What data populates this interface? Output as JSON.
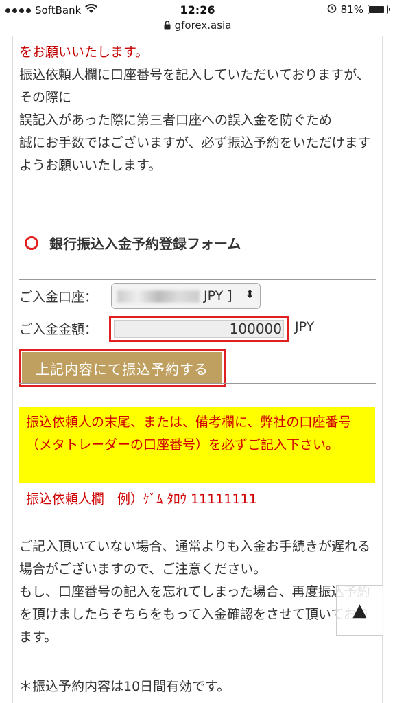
{
  "status_bar": {
    "carrier": "SoftBank",
    "time": "12:26",
    "battery": "81%"
  },
  "url": "gforex.asia",
  "content": {
    "intro_red": "をお願いいたします。",
    "intro_lines": [
      "振込依頼人欄に口座番号を記入していただいておりますが、その際に",
      "誤記入があった際に第三者口座への誤入金を防ぐため",
      "誠にお手数ではございますが、必ず振込予約をいただけますようお願いいたします。"
    ],
    "section_title": "銀行振込入金予約登録フォーム",
    "form": {
      "account_label": "ご入金口座：",
      "account_value": "JPY ]",
      "amount_label": "ご入金金額：",
      "amount_value": "100000",
      "amount_unit": "JPY",
      "submit_label": "上記内容にて振込予約する"
    },
    "notice": "振込依頼人の末尾、または、備考欄に、弊社の口座番号（メタトレーダーの口座番号）を必ずご記入下さい。",
    "example": "振込依頼人欄　例）ｹﾞﾑ ﾀﾛｳ 11111111",
    "warning_lines": [
      "ご記入頂いていない場合、通常よりも入金お手続きが遅れる場合がございますので、ご注意ください。",
      "もし、口座番号の記入を忘れてしまった場合、再度振込予約を頂けましたらそちらをもって入金確認をさせて頂いております。"
    ],
    "validity": "＊振込予約内容は10日間有効です。"
  }
}
